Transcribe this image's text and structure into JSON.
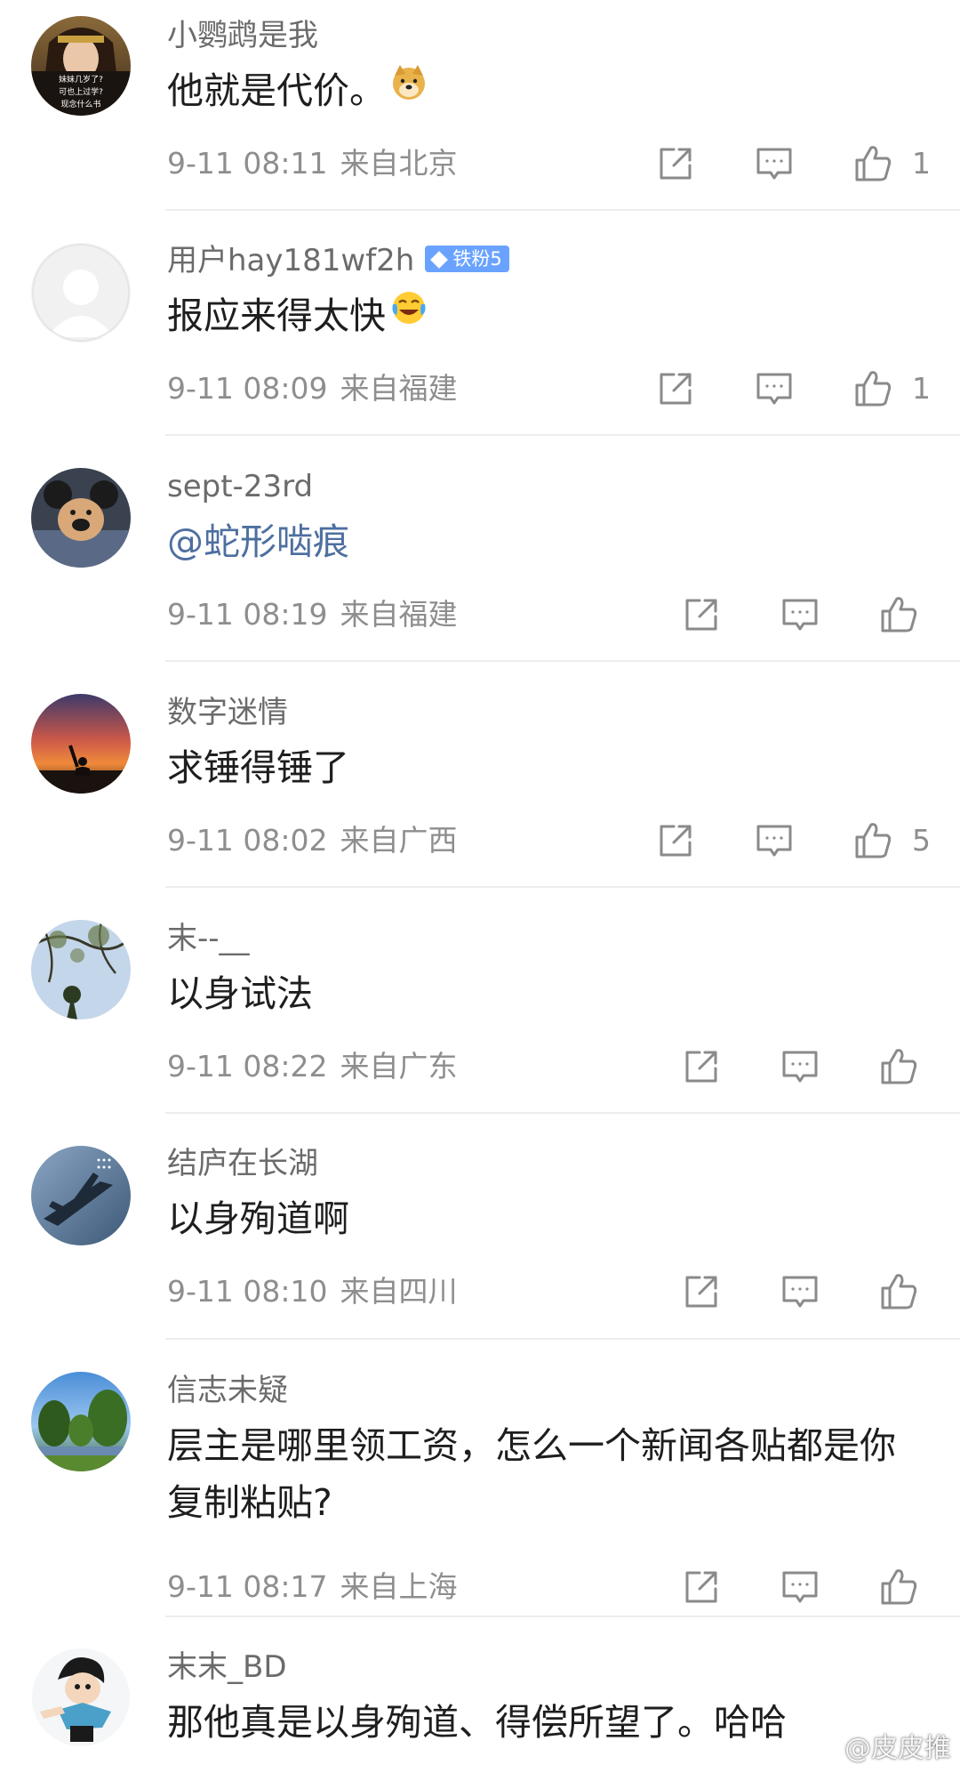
{
  "comments": [
    {
      "username": "小鹦鹉是我",
      "text": "他就是代价。",
      "emoji": "doge-emoji",
      "time": "9-11 08:11",
      "location": "来自北京",
      "likes": "1",
      "avatar": "costume-character-photo",
      "avatar_captions": [
        "妹妹几岁了?",
        "可也上过学?",
        "现念什么书"
      ]
    },
    {
      "username": "用户hay181wf2h",
      "badge": "铁粉5",
      "text": "报应来得太快",
      "emoji": "laugh-cry-emoji",
      "time": "9-11 08:09",
      "location": "来自福建",
      "likes": "1",
      "avatar": "default-user-silhouette"
    },
    {
      "username": "sept-23rd",
      "text": "@蛇形啮痕",
      "mention": true,
      "time": "9-11 08:19",
      "location": "来自福建",
      "likes": "",
      "avatar": "plush-toy-photo"
    },
    {
      "username": "数字迷情",
      "text": "求锤得锤了",
      "time": "9-11 08:02",
      "location": "来自广西",
      "likes": "5",
      "avatar": "sunset-silhouette-photo"
    },
    {
      "username": "末--__",
      "text": "以身试法",
      "time": "9-11 08:22",
      "location": "来自广东",
      "likes": "",
      "avatar": "tree-branches-sky-photo"
    },
    {
      "username": "结庐在长湖",
      "text": "以身殉道啊",
      "time": "9-11 08:10",
      "location": "来自四川",
      "likes": "",
      "avatar": "fighter-jet-photo"
    },
    {
      "username": "信志未疑",
      "text": "层主是哪里领工资，怎么一个新闻各贴都是你复制粘贴?",
      "time": "9-11 08:17",
      "location": "来自上海",
      "likes": "",
      "avatar": "park-trees-photo"
    },
    {
      "username": "末末_BD",
      "text": "那他真是以身殉道、得偿所望了。哈哈",
      "time": "",
      "location": "",
      "likes": "",
      "avatar": "cartoon-robot-boy"
    }
  ],
  "icons": {
    "share": "share-icon",
    "comment": "comment-icon",
    "like": "like-icon"
  },
  "colors": {
    "mention": "#4e6fa0",
    "meta": "#8e8e8e",
    "badge": "#6aa3ff"
  },
  "watermark": "@皮皮推"
}
